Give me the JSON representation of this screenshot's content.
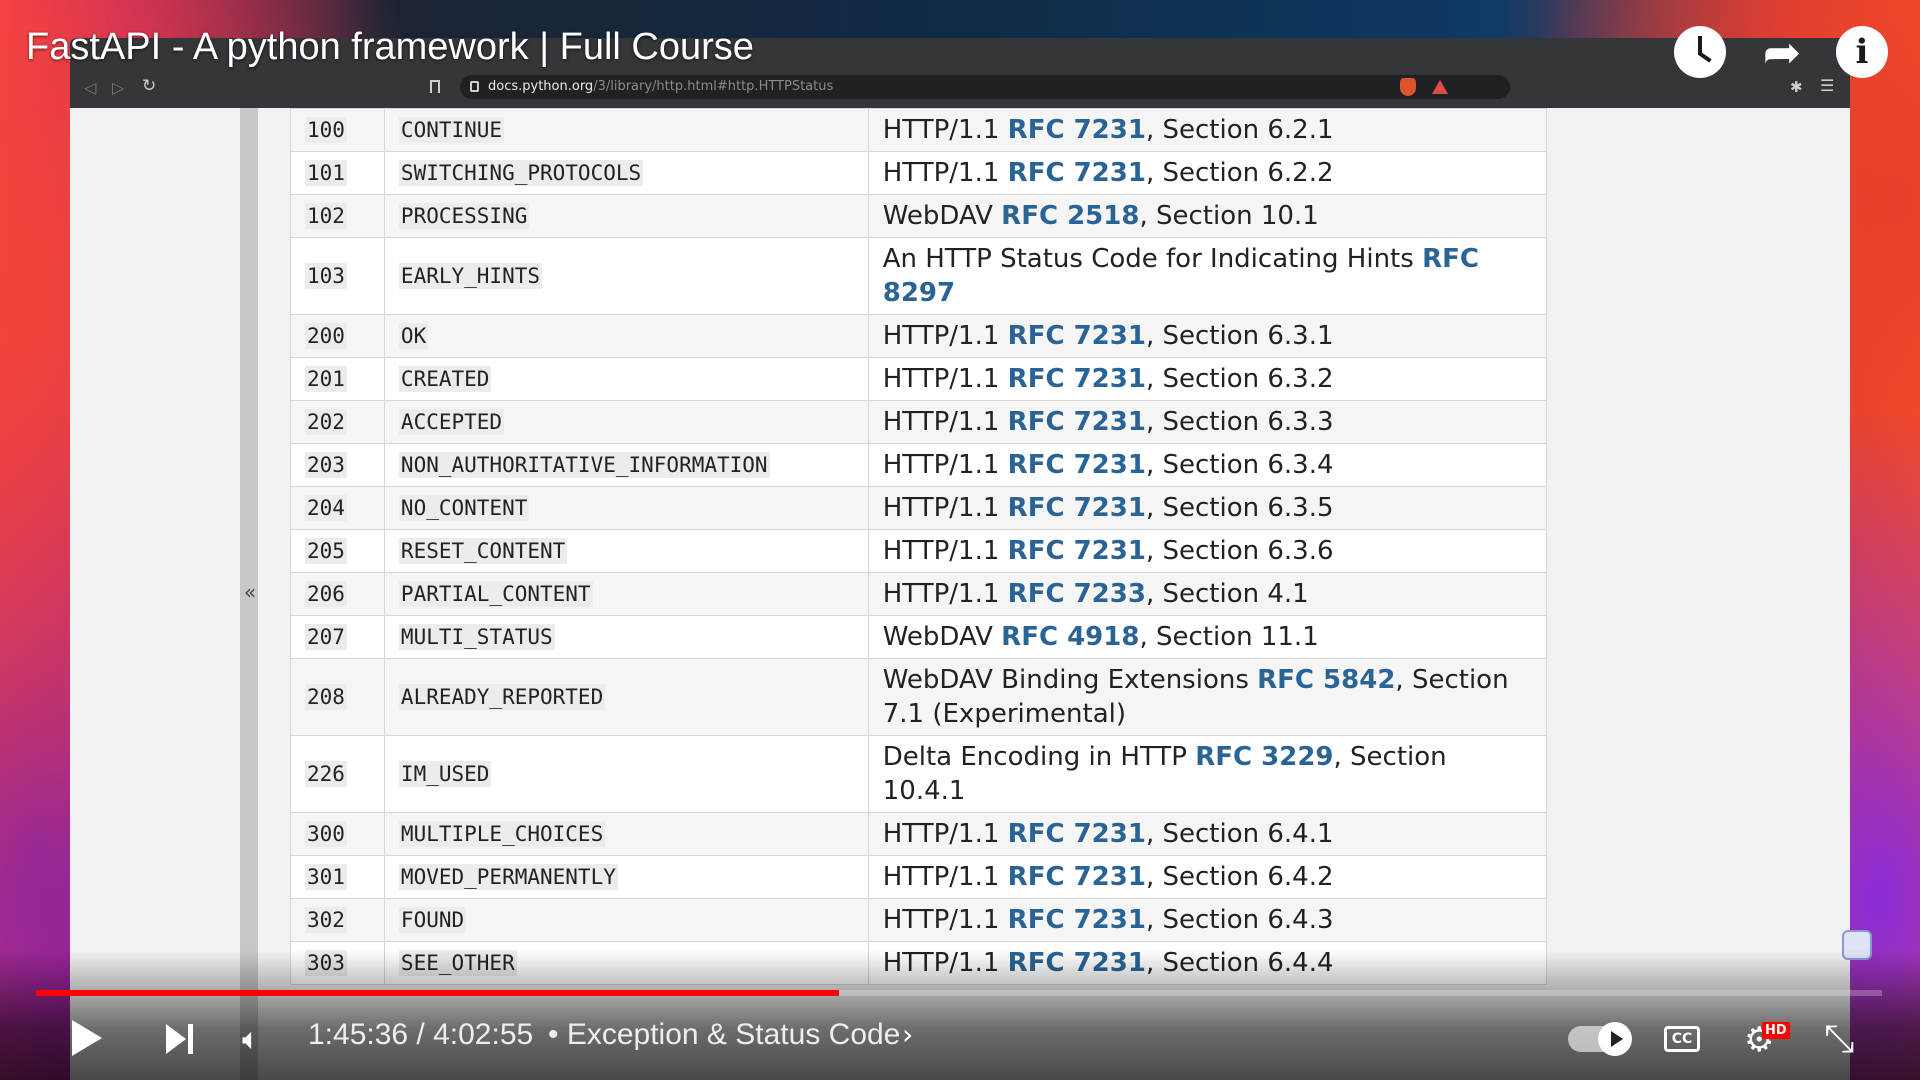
{
  "video": {
    "title": "FastAPI - A python framework | Full Course",
    "time_current": "1:45:36",
    "time_total": "4:02:55",
    "time_display": "1:45:36 / 4:02:55",
    "chapter": "• Exception & Status Code",
    "progress": 0.435,
    "hd_badge": "HD",
    "cc_label": "CC"
  },
  "browser": {
    "url_host": "docs.python.org",
    "url_path": "/3/library/http.html#http.HTTPStatus"
  },
  "page": {
    "sidebar_collapse": "«"
  },
  "status_table": {
    "rows": [
      {
        "code": "100",
        "name": "CONTINUE",
        "pre": "HTTP/1.1 ",
        "rfc": "RFC 7231",
        "post": ", Section 6.2.1"
      },
      {
        "code": "101",
        "name": "SWITCHING_PROTOCOLS",
        "pre": "HTTP/1.1 ",
        "rfc": "RFC 7231",
        "post": ", Section 6.2.2"
      },
      {
        "code": "102",
        "name": "PROCESSING",
        "pre": "WebDAV ",
        "rfc": "RFC 2518",
        "post": ", Section 10.1"
      },
      {
        "code": "103",
        "name": "EARLY_HINTS",
        "pre": "An HTTP Status Code for Indicating Hints ",
        "rfc": "RFC 8297",
        "post": ""
      },
      {
        "code": "200",
        "name": "OK",
        "pre": "HTTP/1.1 ",
        "rfc": "RFC 7231",
        "post": ", Section 6.3.1"
      },
      {
        "code": "201",
        "name": "CREATED",
        "pre": "HTTP/1.1 ",
        "rfc": "RFC 7231",
        "post": ", Section 6.3.2"
      },
      {
        "code": "202",
        "name": "ACCEPTED",
        "pre": "HTTP/1.1 ",
        "rfc": "RFC 7231",
        "post": ", Section 6.3.3"
      },
      {
        "code": "203",
        "name": "NON_AUTHORITATIVE_INFORMATION",
        "pre": "HTTP/1.1 ",
        "rfc": "RFC 7231",
        "post": ", Section 6.3.4"
      },
      {
        "code": "204",
        "name": "NO_CONTENT",
        "pre": "HTTP/1.1 ",
        "rfc": "RFC 7231",
        "post": ", Section 6.3.5"
      },
      {
        "code": "205",
        "name": "RESET_CONTENT",
        "pre": "HTTP/1.1 ",
        "rfc": "RFC 7231",
        "post": ", Section 6.3.6"
      },
      {
        "code": "206",
        "name": "PARTIAL_CONTENT",
        "pre": "HTTP/1.1 ",
        "rfc": "RFC 7233",
        "post": ", Section 4.1"
      },
      {
        "code": "207",
        "name": "MULTI_STATUS",
        "pre": "WebDAV ",
        "rfc": "RFC 4918",
        "post": ", Section 11.1"
      },
      {
        "code": "208",
        "name": "ALREADY_REPORTED",
        "pre": "WebDAV Binding Extensions ",
        "rfc": "RFC 5842",
        "post": ", Section 7.1 (Experimental)"
      },
      {
        "code": "226",
        "name": "IM_USED",
        "pre": "Delta Encoding in HTTP ",
        "rfc": "RFC 3229",
        "post": ", Section 10.4.1"
      },
      {
        "code": "300",
        "name": "MULTIPLE_CHOICES",
        "pre": "HTTP/1.1 ",
        "rfc": "RFC 7231",
        "post": ", Section 6.4.1"
      },
      {
        "code": "301",
        "name": "MOVED_PERMANENTLY",
        "pre": "HTTP/1.1 ",
        "rfc": "RFC 7231",
        "post": ", Section 6.4.2"
      },
      {
        "code": "302",
        "name": "FOUND",
        "pre": "HTTP/1.1 ",
        "rfc": "RFC 7231",
        "post": ", Section 6.4.3"
      },
      {
        "code": "303",
        "name": "SEE_OTHER",
        "pre": "HTTP/1.1 ",
        "rfc": "RFC 7231",
        "post": ", Section 6.4.4"
      }
    ]
  },
  "icons": {
    "watch_later": "clock-icon",
    "share": "share-arrow-icon",
    "info": "info-icon",
    "play": "play-icon",
    "next": "skip-next-icon",
    "volume": "volume-icon",
    "settings": "gear-icon",
    "fullscreen_exit": "fullscreen-exit-icon"
  },
  "colors": {
    "progress_played": "#ff0000",
    "rfc_link": "#2a6496",
    "hd_badge": "#ff0000"
  }
}
